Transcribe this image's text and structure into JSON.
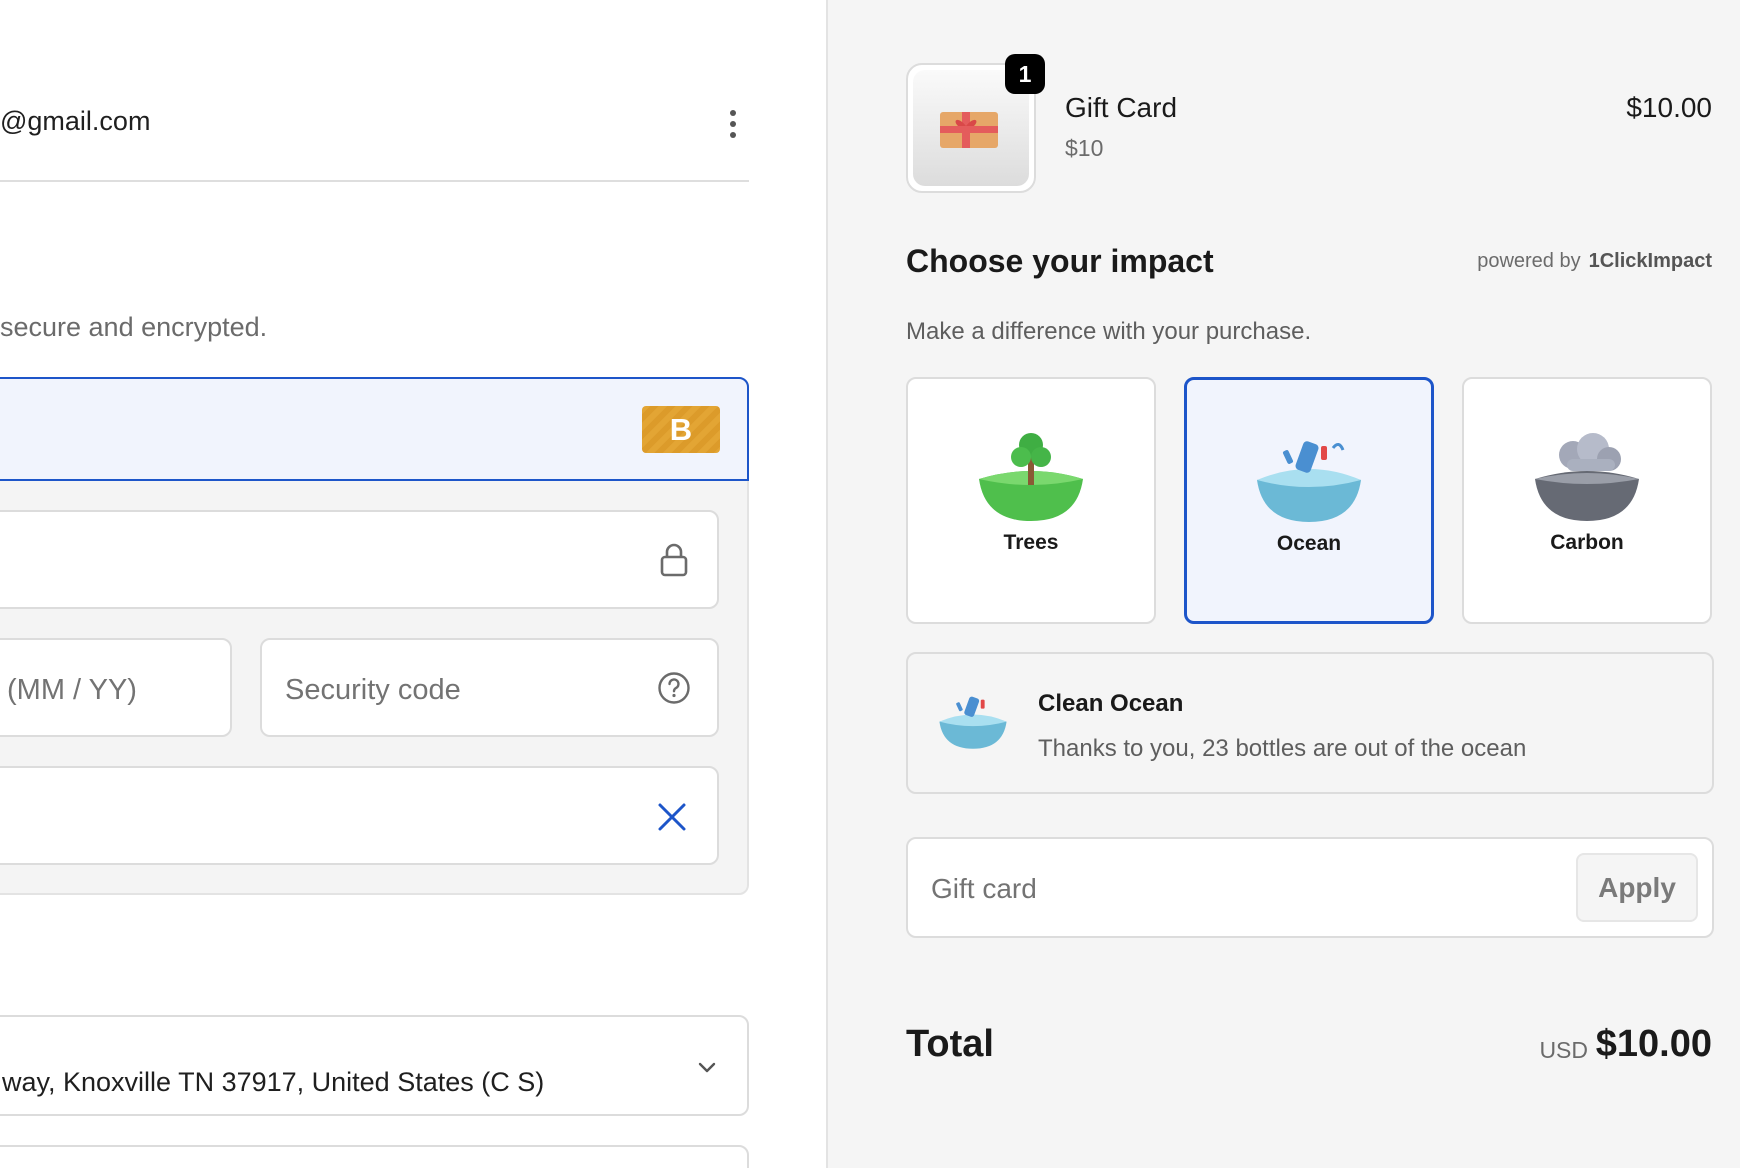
{
  "account": {
    "email_visible": "@gmail.com"
  },
  "payment": {
    "secure_note": "secure and encrypted.",
    "badge_letter": "B",
    "expiry_placeholder": "(MM / YY)",
    "security_placeholder": "Security code"
  },
  "billing": {
    "address_value": "way, Knoxville TN 37917, United States (C S)"
  },
  "order": {
    "item": {
      "name": "Gift Card",
      "variant": "$10",
      "price": "$10.00",
      "quantity": "1"
    }
  },
  "impact": {
    "title": "Choose your impact",
    "powered_by": "powered by",
    "provider": "1ClickImpact",
    "subtitle": "Make a difference with your purchase.",
    "options": [
      {
        "label": "Trees",
        "icon": "tree-island-icon"
      },
      {
        "label": "Ocean",
        "icon": "ocean-bottles-icon",
        "selected": true
      },
      {
        "label": "Carbon",
        "icon": "carbon-cloud-icon"
      }
    ],
    "summary": {
      "title": "Clean Ocean",
      "text": "Thanks to you, 23 bottles are out of the ocean"
    }
  },
  "gift_card": {
    "placeholder": "Gift card",
    "apply_label": "Apply"
  },
  "total": {
    "label": "Total",
    "currency": "USD",
    "amount": "$10.00"
  },
  "colors": {
    "accent": "#1d55c9",
    "selected_bg": "#f1f4fd",
    "badge": "#e3a534"
  }
}
